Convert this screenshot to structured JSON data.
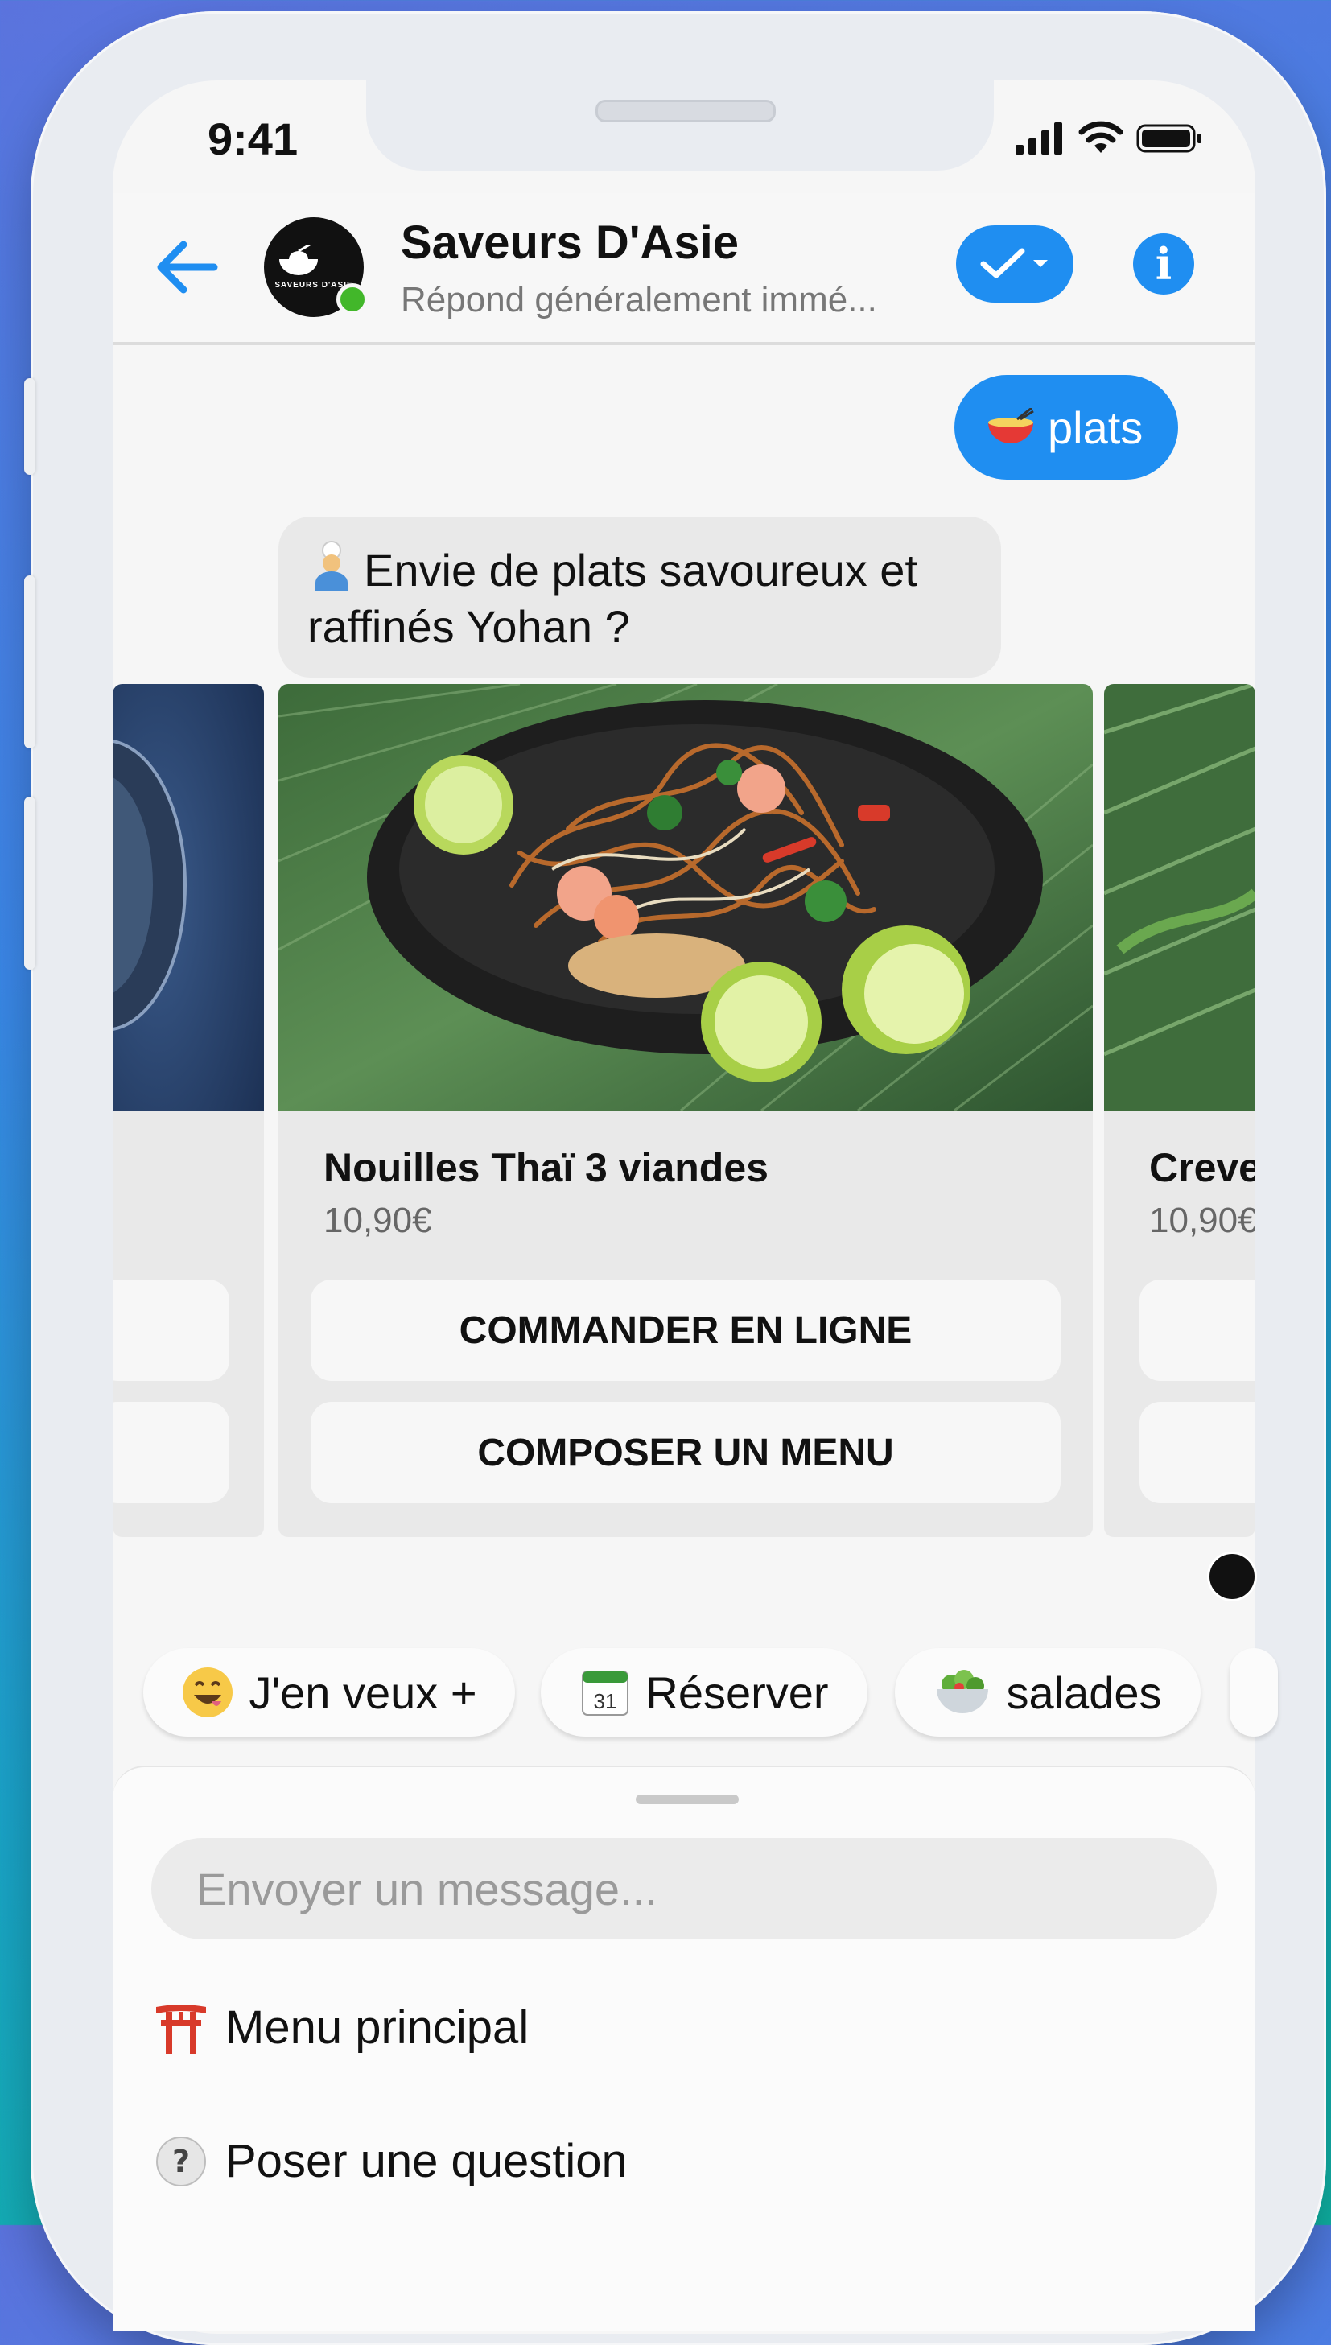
{
  "status_bar": {
    "time": "9:41"
  },
  "header": {
    "page_name": "Saveurs D'Asie",
    "subtitle": "Répond généralement immé...",
    "avatar_text": "SAVEURS D'ASIE"
  },
  "chat": {
    "user_message": "plats",
    "bot_message": "Envie de plats savoureux et raffinés Yohan ?",
    "cards": [
      {
        "title": "Nouilles Thaï 3 viandes",
        "price": "10,90€",
        "buttons": [
          "COMMANDER EN LIGNE",
          "COMPOSER UN MENU"
        ]
      },
      {
        "title": "Creve",
        "price": "10,90€"
      }
    ]
  },
  "quick_replies": [
    {
      "label": "J'en veux +",
      "icon": "grinning-face-icon"
    },
    {
      "label": "Réserver",
      "icon": "calendar-icon",
      "icon_text": "31"
    },
    {
      "label": "salades",
      "icon": "salad-bowl-icon"
    }
  ],
  "composer": {
    "placeholder": "Envoyer un message...",
    "menu": [
      {
        "label": "Menu principal",
        "icon": "torii-gate-icon"
      },
      {
        "label": "Poser une question",
        "icon": "question-icon"
      }
    ]
  },
  "colors": {
    "accent": "#1f8ef1",
    "bubble_grey": "#e9e9e9",
    "online_green": "#42b72a"
  }
}
